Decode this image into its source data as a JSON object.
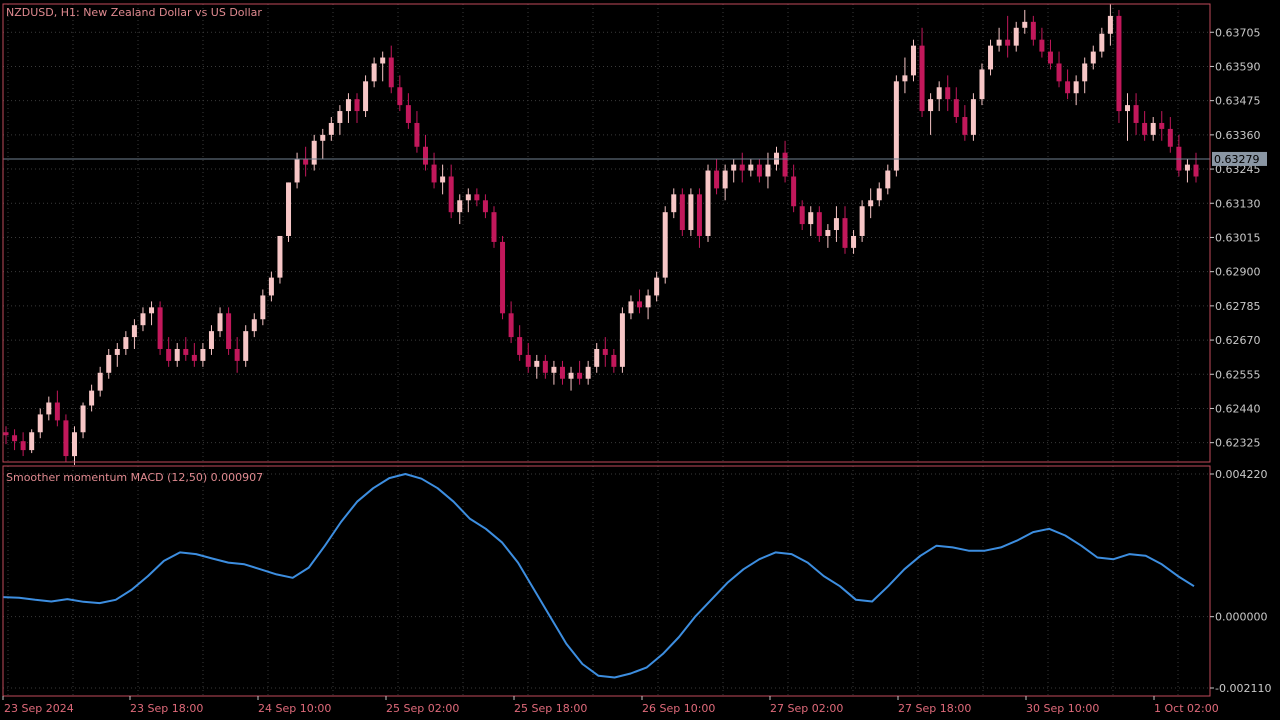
{
  "main_chart": {
    "symbol_label": "NZDUSD, H1:  New Zealand Dollar vs US Dollar",
    "current_price_label": "0.63279",
    "current_price": 0.63279,
    "y_ticks": [
      "0.63705",
      "0.63590",
      "0.63475",
      "0.63360",
      "0.63245",
      "0.63130",
      "0.63015",
      "0.62900",
      "0.62785",
      "0.62670",
      "0.62555",
      "0.62440",
      "0.62325"
    ],
    "y_tick_values": [
      0.63705,
      0.6359,
      0.63475,
      0.6336,
      0.63245,
      0.6313,
      0.63015,
      0.629,
      0.62785,
      0.6267,
      0.62555,
      0.6244,
      0.62325
    ]
  },
  "indicator": {
    "label": "Smoother momentum MACD (12,50) 0.000907",
    "y_ticks": [
      "0.004220",
      "0.000000",
      "-0.002110"
    ],
    "y_tick_values": [
      0.00422,
      0.0,
      -0.00211
    ]
  },
  "x_axis": {
    "labels": [
      "23 Sep 2024",
      "23 Sep 18:00",
      "24 Sep 10:00",
      "25 Sep 02:00",
      "25 Sep 18:00",
      "26 Sep 10:00",
      "27 Sep 02:00",
      "27 Sep 18:00",
      "30 Sep 10:00",
      "1 Oct 02:00"
    ]
  },
  "colors": {
    "background": "#000000",
    "frame": "#c04a5a",
    "axis_text": "#c8c8c8",
    "x_axis_text": "#e06a7a",
    "label_text": "#e08a90",
    "bull_candle": "#f7c6c6",
    "bear_candle": "#c2185b",
    "macd_line": "#3d8ee0",
    "grid": "#3a3a3a",
    "price_line": "#6f7f8f"
  },
  "chart_data": [
    {
      "type": "candlestick",
      "title": "NZDUSD, H1:  New Zealand Dollar vs US Dollar",
      "ylim": [
        0.6226,
        0.638
      ],
      "x_labels": [
        "23 Sep 2024",
        "23 Sep 18:00",
        "24 Sep 10:00",
        "25 Sep 02:00",
        "25 Sep 18:00",
        "26 Sep 10:00",
        "27 Sep 02:00",
        "27 Sep 18:00",
        "30 Sep 10:00",
        "1 Oct 02:00"
      ],
      "ohlc": [
        [
          0.6236,
          0.6238,
          0.6232,
          0.6235
        ],
        [
          0.6235,
          0.6237,
          0.623,
          0.6233
        ],
        [
          0.6233,
          0.6236,
          0.6228,
          0.623
        ],
        [
          0.623,
          0.6237,
          0.6229,
          0.6236
        ],
        [
          0.6236,
          0.6244,
          0.6234,
          0.6242
        ],
        [
          0.6242,
          0.6248,
          0.624,
          0.6246
        ],
        [
          0.6246,
          0.625,
          0.6238,
          0.624
        ],
        [
          0.624,
          0.6242,
          0.6226,
          0.6228
        ],
        [
          0.6228,
          0.6238,
          0.6225,
          0.6236
        ],
        [
          0.6236,
          0.6246,
          0.6234,
          0.6245
        ],
        [
          0.6245,
          0.6252,
          0.6243,
          0.625
        ],
        [
          0.625,
          0.6258,
          0.6248,
          0.6256
        ],
        [
          0.6256,
          0.6264,
          0.6254,
          0.6262
        ],
        [
          0.6262,
          0.6266,
          0.6258,
          0.6264
        ],
        [
          0.6264,
          0.627,
          0.6262,
          0.6268
        ],
        [
          0.6268,
          0.6274,
          0.6264,
          0.6272
        ],
        [
          0.6272,
          0.6278,
          0.627,
          0.6276
        ],
        [
          0.6276,
          0.628,
          0.6272,
          0.6278
        ],
        [
          0.6278,
          0.628,
          0.6262,
          0.6264
        ],
        [
          0.6264,
          0.6268,
          0.6258,
          0.626
        ],
        [
          0.626,
          0.6266,
          0.6258,
          0.6264
        ],
        [
          0.6264,
          0.6268,
          0.626,
          0.6262
        ],
        [
          0.6262,
          0.6266,
          0.6258,
          0.626
        ],
        [
          0.626,
          0.6266,
          0.6258,
          0.6264
        ],
        [
          0.6264,
          0.6272,
          0.6262,
          0.627
        ],
        [
          0.627,
          0.6278,
          0.6268,
          0.6276
        ],
        [
          0.6276,
          0.6278,
          0.6262,
          0.6264
        ],
        [
          0.6264,
          0.6268,
          0.6256,
          0.626
        ],
        [
          0.626,
          0.6272,
          0.6258,
          0.627
        ],
        [
          0.627,
          0.6276,
          0.6268,
          0.6274
        ],
        [
          0.6274,
          0.6284,
          0.6272,
          0.6282
        ],
        [
          0.6282,
          0.629,
          0.628,
          0.6288
        ],
        [
          0.6288,
          0.6302,
          0.6286,
          0.6302
        ],
        [
          0.6302,
          0.632,
          0.63,
          0.632
        ],
        [
          0.632,
          0.633,
          0.6318,
          0.6328
        ],
        [
          0.6328,
          0.6332,
          0.6322,
          0.6326
        ],
        [
          0.6326,
          0.6336,
          0.6324,
          0.6334
        ],
        [
          0.6334,
          0.6338,
          0.6328,
          0.6336
        ],
        [
          0.6336,
          0.6342,
          0.6334,
          0.634
        ],
        [
          0.634,
          0.6346,
          0.6336,
          0.6344
        ],
        [
          0.6344,
          0.635,
          0.634,
          0.6348
        ],
        [
          0.6348,
          0.635,
          0.634,
          0.6344
        ],
        [
          0.6344,
          0.6356,
          0.6342,
          0.6354
        ],
        [
          0.6354,
          0.6362,
          0.6352,
          0.636
        ],
        [
          0.636,
          0.6364,
          0.6354,
          0.6362
        ],
        [
          0.6362,
          0.6366,
          0.635,
          0.6352
        ],
        [
          0.6352,
          0.6356,
          0.6344,
          0.6346
        ],
        [
          0.6346,
          0.635,
          0.6338,
          0.634
        ],
        [
          0.634,
          0.6344,
          0.633,
          0.6332
        ],
        [
          0.6332,
          0.6336,
          0.6324,
          0.6326
        ],
        [
          0.6326,
          0.633,
          0.6318,
          0.632
        ],
        [
          0.632,
          0.6326,
          0.6316,
          0.6322
        ],
        [
          0.6322,
          0.6326,
          0.6308,
          0.631
        ],
        [
          0.631,
          0.6316,
          0.6306,
          0.6314
        ],
        [
          0.6314,
          0.6318,
          0.631,
          0.6316
        ],
        [
          0.6316,
          0.6318,
          0.6312,
          0.6314
        ],
        [
          0.6314,
          0.6316,
          0.6308,
          0.631
        ],
        [
          0.631,
          0.6312,
          0.6298,
          0.63
        ],
        [
          0.63,
          0.6302,
          0.6274,
          0.6276
        ],
        [
          0.6276,
          0.628,
          0.6266,
          0.6268
        ],
        [
          0.6268,
          0.6272,
          0.626,
          0.6262
        ],
        [
          0.6262,
          0.6266,
          0.6256,
          0.6258
        ],
        [
          0.6258,
          0.6262,
          0.6254,
          0.626
        ],
        [
          0.626,
          0.6262,
          0.6254,
          0.6256
        ],
        [
          0.6256,
          0.626,
          0.6252,
          0.6258
        ],
        [
          0.6258,
          0.626,
          0.6252,
          0.6254
        ],
        [
          0.6254,
          0.6258,
          0.625,
          0.6256
        ],
        [
          0.6256,
          0.626,
          0.6252,
          0.6254
        ],
        [
          0.6254,
          0.626,
          0.6252,
          0.6258
        ],
        [
          0.6258,
          0.6266,
          0.6256,
          0.6264
        ],
        [
          0.6264,
          0.6268,
          0.6258,
          0.6262
        ],
        [
          0.6262,
          0.6264,
          0.6256,
          0.6258
        ],
        [
          0.6258,
          0.6278,
          0.6256,
          0.6276
        ],
        [
          0.6276,
          0.6282,
          0.6274,
          0.628
        ],
        [
          0.628,
          0.6284,
          0.6276,
          0.6278
        ],
        [
          0.6278,
          0.6284,
          0.6274,
          0.6282
        ],
        [
          0.6282,
          0.629,
          0.628,
          0.6288
        ],
        [
          0.6288,
          0.6312,
          0.6286,
          0.631
        ],
        [
          0.631,
          0.6318,
          0.6308,
          0.6316
        ],
        [
          0.6316,
          0.6318,
          0.6302,
          0.6304
        ],
        [
          0.6304,
          0.6318,
          0.6302,
          0.6316
        ],
        [
          0.6316,
          0.6318,
          0.6298,
          0.6302
        ],
        [
          0.6302,
          0.6326,
          0.63,
          0.6324
        ],
        [
          0.6324,
          0.6328,
          0.6316,
          0.6318
        ],
        [
          0.6318,
          0.6326,
          0.6314,
          0.6324
        ],
        [
          0.6324,
          0.6328,
          0.632,
          0.6326
        ],
        [
          0.6326,
          0.633,
          0.632,
          0.6324
        ],
        [
          0.6324,
          0.6328,
          0.6322,
          0.6326
        ],
        [
          0.6326,
          0.6328,
          0.632,
          0.6322
        ],
        [
          0.6322,
          0.633,
          0.6318,
          0.6326
        ],
        [
          0.6326,
          0.6332,
          0.6324,
          0.633
        ],
        [
          0.633,
          0.6334,
          0.632,
          0.6322
        ],
        [
          0.6322,
          0.6326,
          0.631,
          0.6312
        ],
        [
          0.6312,
          0.6314,
          0.6304,
          0.6306
        ],
        [
          0.6306,
          0.6312,
          0.6302,
          0.631
        ],
        [
          0.631,
          0.6312,
          0.63,
          0.6302
        ],
        [
          0.6302,
          0.6306,
          0.6298,
          0.6304
        ],
        [
          0.6304,
          0.6312,
          0.63,
          0.6308
        ],
        [
          0.6308,
          0.6312,
          0.6296,
          0.6298
        ],
        [
          0.6298,
          0.6304,
          0.6296,
          0.6302
        ],
        [
          0.6302,
          0.6314,
          0.63,
          0.6312
        ],
        [
          0.6312,
          0.6318,
          0.6308,
          0.6314
        ],
        [
          0.6314,
          0.632,
          0.6312,
          0.6318
        ],
        [
          0.6318,
          0.6326,
          0.6316,
          0.6324
        ],
        [
          0.6324,
          0.6356,
          0.6322,
          0.6354
        ],
        [
          0.6354,
          0.6362,
          0.635,
          0.6356
        ],
        [
          0.6356,
          0.6368,
          0.6354,
          0.6366
        ],
        [
          0.6366,
          0.6372,
          0.6342,
          0.6344
        ],
        [
          0.6344,
          0.635,
          0.6336,
          0.6348
        ],
        [
          0.6348,
          0.6354,
          0.6344,
          0.6352
        ],
        [
          0.6352,
          0.6356,
          0.6344,
          0.6348
        ],
        [
          0.6348,
          0.6352,
          0.634,
          0.6342
        ],
        [
          0.6342,
          0.6346,
          0.6334,
          0.6336
        ],
        [
          0.6336,
          0.635,
          0.6334,
          0.6348
        ],
        [
          0.6348,
          0.636,
          0.6346,
          0.6358
        ],
        [
          0.6358,
          0.6368,
          0.6356,
          0.6366
        ],
        [
          0.6366,
          0.6372,
          0.6364,
          0.6368
        ],
        [
          0.6368,
          0.6376,
          0.6362,
          0.6366
        ],
        [
          0.6366,
          0.6374,
          0.6364,
          0.6372
        ],
        [
          0.6372,
          0.6378,
          0.637,
          0.6374
        ],
        [
          0.6374,
          0.6376,
          0.6366,
          0.6368
        ],
        [
          0.6368,
          0.6372,
          0.6362,
          0.6364
        ],
        [
          0.6364,
          0.6368,
          0.6358,
          0.636
        ],
        [
          0.636,
          0.6364,
          0.6352,
          0.6354
        ],
        [
          0.6354,
          0.6358,
          0.6348,
          0.635
        ],
        [
          0.635,
          0.6356,
          0.6346,
          0.6354
        ],
        [
          0.6354,
          0.6362,
          0.635,
          0.636
        ],
        [
          0.636,
          0.6366,
          0.6358,
          0.6364
        ],
        [
          0.6364,
          0.6372,
          0.6362,
          0.637
        ],
        [
          0.637,
          0.638,
          0.6366,
          0.6376
        ],
        [
          0.6376,
          0.6378,
          0.634,
          0.6344
        ],
        [
          0.6344,
          0.635,
          0.6334,
          0.6346
        ],
        [
          0.6346,
          0.635,
          0.6336,
          0.634
        ],
        [
          0.634,
          0.6344,
          0.6334,
          0.6336
        ],
        [
          0.6336,
          0.6342,
          0.6334,
          0.634
        ],
        [
          0.634,
          0.6344,
          0.6334,
          0.6338
        ],
        [
          0.6338,
          0.6342,
          0.633,
          0.6332
        ],
        [
          0.6332,
          0.6336,
          0.6322,
          0.6324
        ],
        [
          0.6324,
          0.6328,
          0.632,
          0.6326
        ],
        [
          0.6326,
          0.633,
          0.632,
          0.6322
        ]
      ]
    },
    {
      "type": "line",
      "title": "Smoother momentum MACD (12,50) 0.000907",
      "ylim": [
        -0.00211,
        0.00422
      ],
      "series": [
        {
          "name": "Smoother momentum MACD (12,50)",
          "values": [
            0.00058,
            0.00056,
            0.0005,
            0.00045,
            0.00052,
            0.00044,
            0.0004,
            0.0005,
            0.0008,
            0.0012,
            0.00165,
            0.0019,
            0.00185,
            0.00172,
            0.0016,
            0.00155,
            0.0014,
            0.00125,
            0.00115,
            0.00145,
            0.0021,
            0.0028,
            0.0034,
            0.0038,
            0.0041,
            0.00422,
            0.00408,
            0.0038,
            0.0034,
            0.0029,
            0.0026,
            0.0022,
            0.0016,
            0.0008,
            0.0,
            -0.0008,
            -0.0014,
            -0.00175,
            -0.0018,
            -0.00168,
            -0.0015,
            -0.0011,
            -0.0006,
            0.0,
            0.0005,
            0.001,
            0.0014,
            0.0017,
            0.0019,
            0.00185,
            0.0016,
            0.0012,
            0.0009,
            0.0005,
            0.00045,
            0.0009,
            0.0014,
            0.0018,
            0.0021,
            0.00205,
            0.00195,
            0.00195,
            0.00205,
            0.00225,
            0.0025,
            0.0026,
            0.0024,
            0.0021,
            0.00175,
            0.0017,
            0.00185,
            0.0018,
            0.00155,
            0.0012,
            0.0009
          ]
        }
      ]
    }
  ]
}
